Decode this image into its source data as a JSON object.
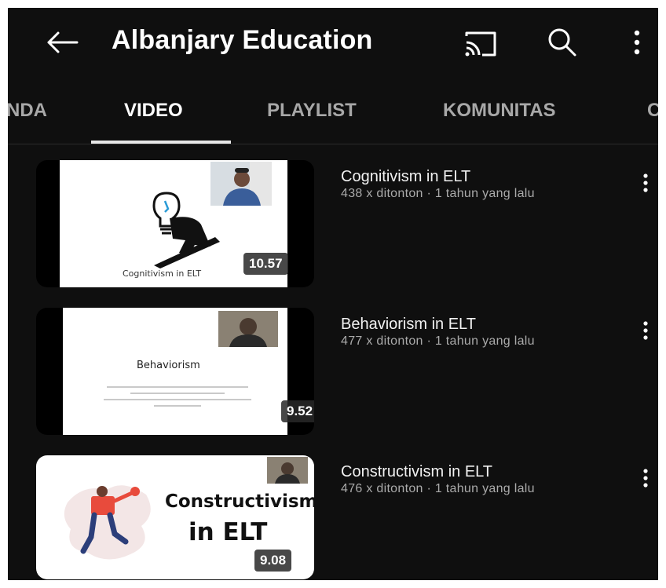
{
  "app": {
    "channel_title": "Albanjary Education",
    "icons": [
      "back-arrow-icon",
      "cast-icon",
      "search-icon",
      "more-vert-icon"
    ]
  },
  "tabs": [
    {
      "label": "NDA",
      "active": false
    },
    {
      "label": "VIDEO",
      "active": true
    },
    {
      "label": "PLAYLIST",
      "active": false
    },
    {
      "label": "KOMUNITAS",
      "active": false
    },
    {
      "label": "C",
      "active": false
    }
  ],
  "videos": [
    {
      "title": "Cognitivism in ELT",
      "meta": "438 x ditonton · 1 tahun yang lalu",
      "duration": "10.57",
      "thumb_text": "Cognitivism in ELT"
    },
    {
      "title": "Behaviorism in ELT",
      "meta": "477 x ditonton · 1 tahun yang lalu",
      "duration": "9.52",
      "thumb_text": "Behaviorism"
    },
    {
      "title": "Constructivism in ELT",
      "meta": "476 x ditonton · 1 tahun yang lalu",
      "duration": "9.08",
      "thumb_line1": "Constructivism",
      "thumb_line2": "in ELT"
    }
  ],
  "colors": {
    "background": "#0f0f0f",
    "text_primary": "#f1f1f1",
    "text_secondary": "#aaaaaa",
    "tab_inactive": "#a8a8a8"
  }
}
